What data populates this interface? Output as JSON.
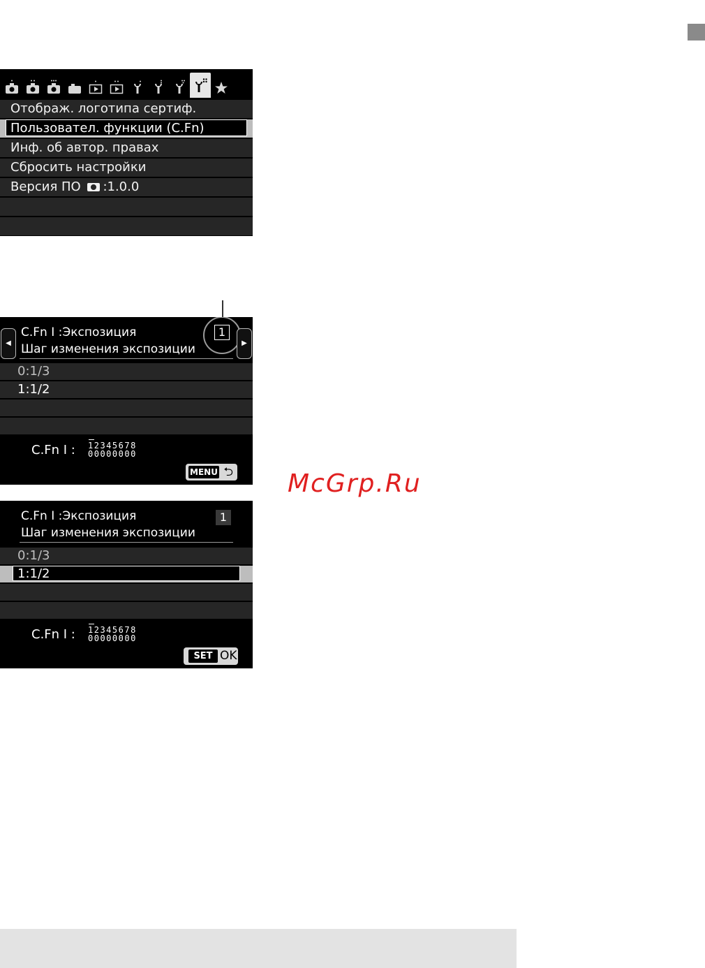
{
  "page": {
    "watermark": "McGrp.Ru"
  },
  "menu_screen": {
    "tabs": [
      {
        "icon": "shooting-1-icon"
      },
      {
        "icon": "shooting-2-icon"
      },
      {
        "icon": "shooting-3-icon"
      },
      {
        "icon": "shooting-4-icon"
      },
      {
        "icon": "playback-1-icon"
      },
      {
        "icon": "playback-2-icon"
      },
      {
        "icon": "setup-1-icon"
      },
      {
        "icon": "setup-2-icon"
      },
      {
        "icon": "setup-3-icon"
      },
      {
        "icon": "setup-4-icon",
        "active": true
      },
      {
        "icon": "my-menu-star-icon"
      }
    ],
    "items": [
      {
        "label": "Отображ. логотипа сертиф."
      },
      {
        "label": "Пользовател. функции (C.Fn)",
        "selected": true
      },
      {
        "label": "Инф. об автор. правах"
      },
      {
        "label": "Сбросить настройки"
      },
      {
        "label_prefix": "Версия ПО",
        "label_suffix": ":1.0.0"
      },
      {
        "label": ""
      },
      {
        "label": ""
      }
    ]
  },
  "cfn_screen_1": {
    "title": "C.Fn Ⅰ :Экспозиция",
    "subtitle": "Шаг изменения экспозиции",
    "number": "1",
    "options": [
      "0:1/3",
      "1:1/2"
    ],
    "footer_label": "C.Fn Ⅰ :",
    "digits_top": "12345678",
    "digits_bottom": "00000000",
    "menu_button": "MENU",
    "return_symbol": "⮌"
  },
  "cfn_screen_2": {
    "title": "C.Fn Ⅰ :Экспозиция",
    "subtitle": "Шаг изменения экспозиции",
    "number": "1",
    "options": [
      "0:1/3",
      "1:1/2"
    ],
    "selected_index": 1,
    "footer_label": "C.Fn Ⅰ :",
    "digits_top": "12345678",
    "digits_bottom": "00000000",
    "set_button": "SET",
    "ok_label": "OK"
  }
}
